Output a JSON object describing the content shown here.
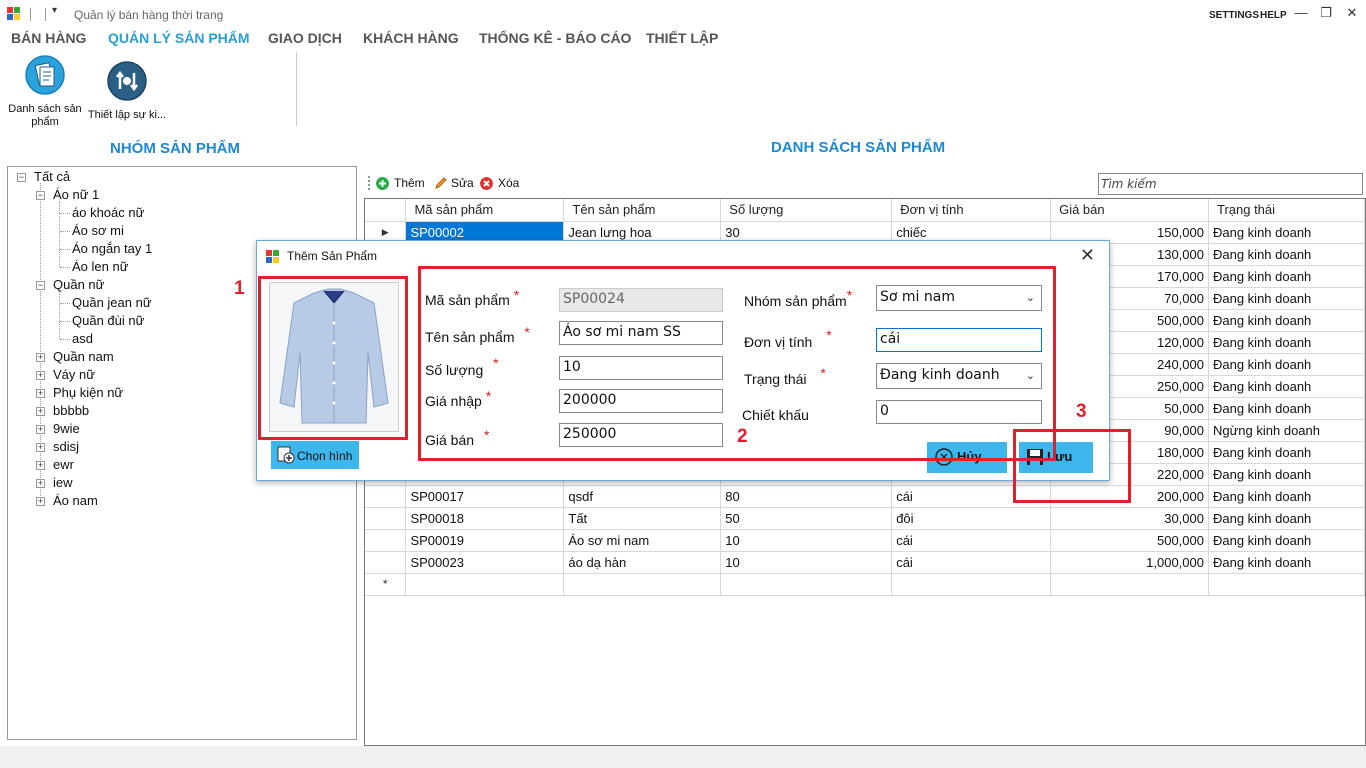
{
  "window": {
    "title": "Quản lý bán hàng thời trang",
    "settings": "SETTINGS",
    "help": "HELP",
    "qa_arrow": "▾",
    "minimize": "—",
    "restore": "❐",
    "close": "✕"
  },
  "menu": {
    "items": [
      {
        "label": "BÁN HÀNG"
      },
      {
        "label": "QUẢN LÝ SẢN PHẨM"
      },
      {
        "label": "GIAO DỊCH"
      },
      {
        "label": "KHÁCH HÀNG"
      },
      {
        "label": "THỐNG KÊ - BÁO CÁO"
      },
      {
        "label": "THIẾT LẬP"
      }
    ]
  },
  "ribbon": {
    "product_list": "Danh sách sản phẩm",
    "settings_btn": "Thiết lập sự ki..."
  },
  "left": {
    "heading": "NHÓM SẢN PHẨM",
    "tree": {
      "root": "Tất cả",
      "nodes": [
        "Áo nữ 1",
        "áo khoác nữ",
        "Áo sơ mi",
        "Áo ngắn tay 1",
        "Áo len nữ",
        "Quần nữ",
        "Quần jean nữ",
        "Quần đùi nữ",
        "asd",
        "Quần nam",
        "Váy nữ",
        "Phụ kiện nữ",
        "bbbbb",
        "9wie",
        "sdisj",
        "ewr",
        "iew",
        "Áo nam"
      ]
    }
  },
  "right": {
    "heading": "DANH SÁCH SẢN PHẨM",
    "toolbar": {
      "add": "Thêm",
      "edit": "Sửa",
      "delete": "Xóa"
    },
    "search_placeholder": "Tìm kiếm",
    "columns": [
      "Mã sản phẩm",
      "Tên sản phẩm",
      "Số lượng",
      "Đơn vị tính",
      "Giá bán",
      "Trạng thái"
    ],
    "rows": [
      [
        "SP00002",
        "Jean lưng hoa",
        "30",
        "chiếc",
        "150,000",
        "Đang kinh doanh"
      ],
      [
        "",
        "",
        "",
        "",
        "130,000",
        "Đang kinh doanh"
      ],
      [
        "",
        "",
        "",
        "",
        "170,000",
        "Đang kinh doanh"
      ],
      [
        "",
        "",
        "",
        "",
        "70,000",
        "Đang kinh doanh"
      ],
      [
        "",
        "",
        "",
        "",
        "500,000",
        "Đang kinh doanh"
      ],
      [
        "",
        "",
        "",
        "",
        "120,000",
        "Đang kinh doanh"
      ],
      [
        "",
        "",
        "",
        "",
        "240,000",
        "Đang kinh doanh"
      ],
      [
        "",
        "",
        "",
        "",
        "250,000",
        "Đang kinh doanh"
      ],
      [
        "",
        "",
        "",
        "",
        "50,000",
        "Đang kinh doanh"
      ],
      [
        "",
        "",
        "",
        "",
        "90,000",
        "Ngừng kinh doanh"
      ],
      [
        "",
        "",
        "",
        "",
        "180,000",
        "Đang kinh doanh"
      ],
      [
        "",
        "",
        "",
        "",
        "220,000",
        "Đang kinh doanh"
      ],
      [
        "SP00017",
        "qsdf",
        "80",
        "cái",
        "200,000",
        "Đang kinh doanh"
      ],
      [
        "SP00018",
        "Tất",
        "50",
        "đôi",
        "30,000",
        "Đang kinh doanh"
      ],
      [
        "SP00019",
        "Áo sơ mi nam",
        "10",
        "cái",
        "500,000",
        "Đang kinh doanh"
      ],
      [
        "SP00023",
        "áo dạ hàn",
        "10",
        "cái",
        "1,000,000",
        "Đang kinh doanh"
      ]
    ],
    "new_row_marker": "*",
    "current_row_marker": "▶"
  },
  "dialog": {
    "title": "Thêm Sản Phẩm",
    "close": "✕",
    "choose_image": "Chọn hình",
    "required_mark": "*",
    "fields": {
      "code_label": "Mã sản phẩm",
      "code_value": "SP00024",
      "name_label": "Tên sản phẩm",
      "name_value": "Áo sơ mi nam SS",
      "qty_label": "Số lượng",
      "qty_value": "10",
      "import_price_label": "Giá nhập",
      "import_price_value": "200000",
      "price_label": "Giá bán",
      "price_value": "250000",
      "group_label": "Nhóm sản phẩm",
      "group_value": "Sơ mi nam",
      "unit_label": "Đơn vị tính",
      "unit_value": "cái",
      "status_label": "Trạng thái",
      "status_value": "Đang kinh doanh",
      "discount_label": "Chiết khấu",
      "discount_value": "0"
    },
    "cancel": "Hủy",
    "save": "Lưu"
  },
  "annotations": {
    "n1": "1",
    "n2": "2",
    "n3": "3"
  },
  "colors": {
    "accent": "#2a9fd6",
    "heading": "#1e88d2",
    "annotation": "#e0202a",
    "button": "#3db6ec",
    "selected": "#0078d7"
  }
}
